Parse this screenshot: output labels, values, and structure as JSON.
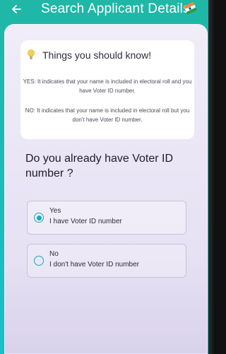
{
  "header": {
    "title": "Search Applicant Details",
    "back_icon": "arrow-left-icon",
    "flag_icon": "election-flag-icon"
  },
  "info": {
    "icon": "lightbulb-icon",
    "title": "Things you should know!",
    "yes_text": "YES: It indicates that your name is included in electoral roll and you have Voter ID number.",
    "no_text": "NO: It indicates that your name is included in electoral roll but you don't have Voter ID number."
  },
  "question": "Do you already have Voter ID number ?",
  "options": [
    {
      "label": "Yes",
      "description": "I have Voter ID number",
      "selected": true
    },
    {
      "label": "No",
      "description": "I don't have Voter ID number",
      "selected": false
    }
  ],
  "colors": {
    "header_bg": "#1fb7a6",
    "radio_accent": "#1aa8b8",
    "card_bg": "#ece8f6"
  }
}
